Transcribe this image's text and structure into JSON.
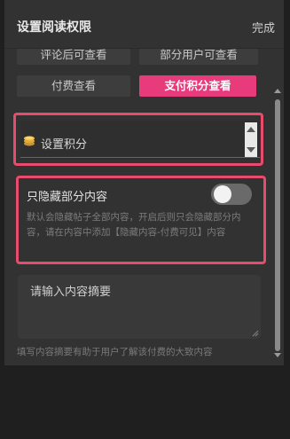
{
  "header": {
    "title": "设置阅读权限",
    "done_label": "完成"
  },
  "options": [
    {
      "label": "评论后可查看",
      "active": false
    },
    {
      "label": "部分用户可查看",
      "active": false
    },
    {
      "label": "付费查看",
      "active": false
    },
    {
      "label": "支付积分查看",
      "active": true
    }
  ],
  "score": {
    "label": "设置积分",
    "icon": "coin-stack-icon"
  },
  "hide_partial": {
    "title": "只隐藏部分内容",
    "enabled": false,
    "description": "默认会隐藏帖子全部内容，开启后则只会隐藏部分内容，请在内容中添加【隐藏内容-付费可见】内容"
  },
  "summary": {
    "placeholder": "请输入内容摘要",
    "hint": "填写内容摘要有助于用户了解该付费的大致内容"
  },
  "colors": {
    "accent": "#e73b7c",
    "highlight": "#e84b6b",
    "background": "#323233"
  }
}
